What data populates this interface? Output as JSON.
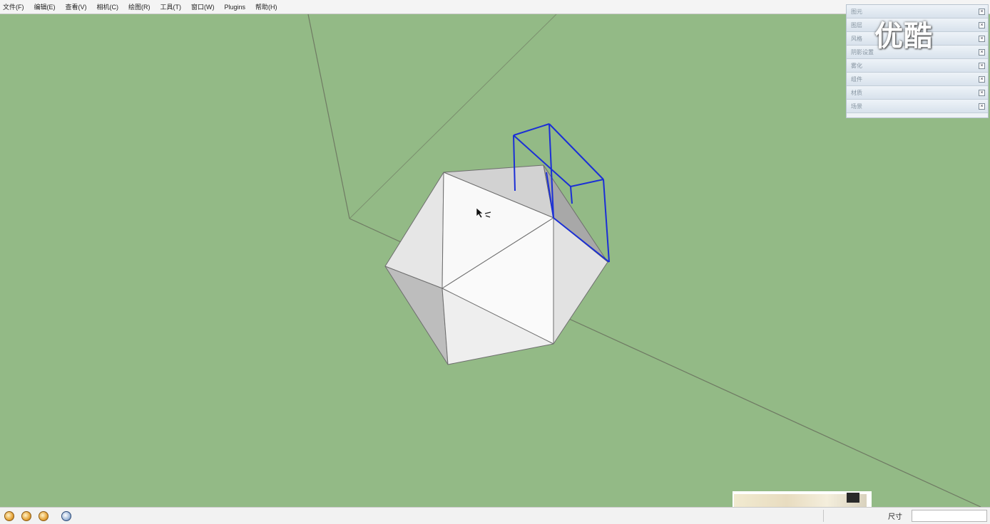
{
  "menu": {
    "items": [
      "文件(F)",
      "编辑(E)",
      "查看(V)",
      "相机(C)",
      "绘图(R)",
      "工具(T)",
      "窗口(W)",
      "Plugins",
      "帮助(H)"
    ]
  },
  "tray": {
    "items": [
      "图元",
      "图层",
      "风格",
      "阴影设置",
      "雾化",
      "组件",
      "材质",
      "场景"
    ],
    "close_glyph": "×"
  },
  "watermark": "优酷",
  "status": {
    "icons": [
      "geo-location-icon",
      "credits-icon",
      "user-icon",
      "help-icon"
    ],
    "hint": "",
    "measure_label": "尺寸",
    "measure_value": ""
  },
  "colors": {
    "ground": "#93ba86",
    "selection": "#1b2fd6",
    "axis": "#6f7a63"
  }
}
